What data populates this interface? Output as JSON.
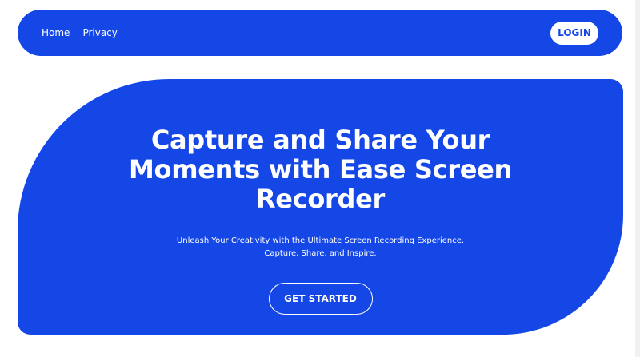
{
  "nav": {
    "links": [
      "Home",
      "Privacy"
    ],
    "login_label": "LOGIN"
  },
  "hero": {
    "title": "Capture and Share Your Moments with Ease Screen Recorder",
    "subtitle_line1": "Unleash Your Creativity with the Ultimate Screen Recording Experience.",
    "subtitle_line2": "Capture, Share, and Inspire.",
    "cta_label": "GET STARTED"
  },
  "colors": {
    "brand": "#1447e6",
    "background": "#ffffff",
    "text_on_brand": "#ffffff"
  }
}
